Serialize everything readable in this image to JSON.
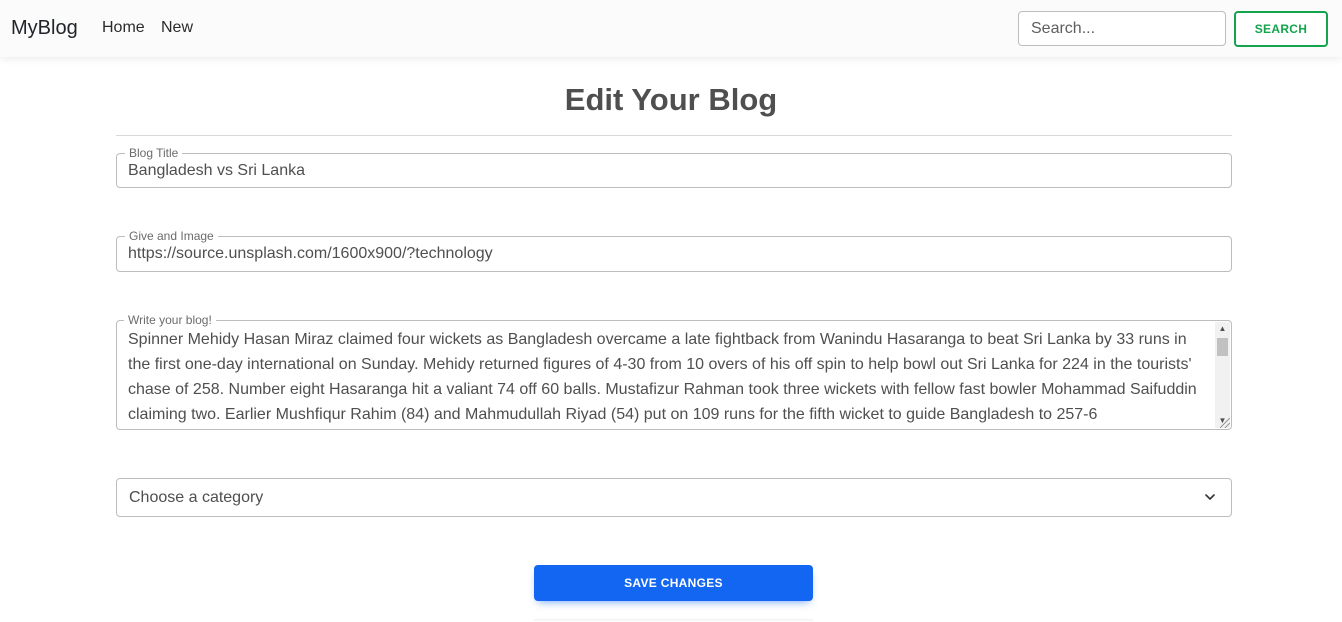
{
  "navbar": {
    "brand": "MyBlog",
    "links": [
      "Home",
      "New"
    ],
    "search_placeholder": "Search...",
    "search_button": "SEARCH"
  },
  "page": {
    "title": "Edit Your Blog"
  },
  "form": {
    "title_label": "Blog Title",
    "title_value": "Bangladesh vs Sri Lanka",
    "image_label": "Give and Image",
    "image_value": "https://source.unsplash.com/1600x900/?technology",
    "blog_label": "Write your blog!",
    "blog_value": "Spinner Mehidy Hasan Miraz claimed four wickets as Bangladesh overcame a late fightback from Wanindu Hasaranga to beat Sri Lanka by 33 runs in the first one-day international on Sunday. Mehidy returned figures of 4-30 from 10 overs of his off spin to help bowl out Sri Lanka for 224 in the tourists' chase of 258. Number eight Hasaranga hit a valiant 74 off 60 balls. Mustafizur Rahman took three wickets with fellow fast bowler Mohammad Saifuddin claiming two. Earlier Mushfiqur Rahim (84) and Mahmudullah Riyad (54) put on 109 runs for the fifth wicket to guide Bangladesh to 257-6",
    "category_value": "Choose a category",
    "save_button": "SAVE CHANGES"
  },
  "colors": {
    "search_accent": "#14a44d",
    "primary": "#1266f1",
    "title_text": "#4f4f4f"
  },
  "icons": {
    "select_chevron": "chevron-down-icon",
    "scroll_up": "arrow-up-icon",
    "scroll_down": "arrow-down-icon"
  }
}
